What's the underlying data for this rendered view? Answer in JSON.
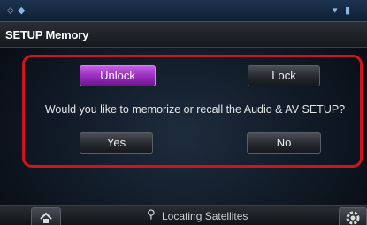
{
  "status_bar": {
    "left_icons": [
      "navigation-icon",
      "settings-dot-icon"
    ],
    "right_icons": [
      "antenna-icon",
      "signal-icon"
    ]
  },
  "title": "SETUP Memory",
  "memory_panel": {
    "unlock_label": "Unlock",
    "lock_label": "Lock",
    "question": "Would you like to memorize or recall the Audio & AV SETUP?",
    "yes_label": "Yes",
    "no_label": "No",
    "selected": "Unlock"
  },
  "bottom_bar": {
    "gps_status": "Locating Satellites"
  },
  "colors": {
    "highlight_border": "#d0141e",
    "active_button": "#9a2ec0"
  }
}
